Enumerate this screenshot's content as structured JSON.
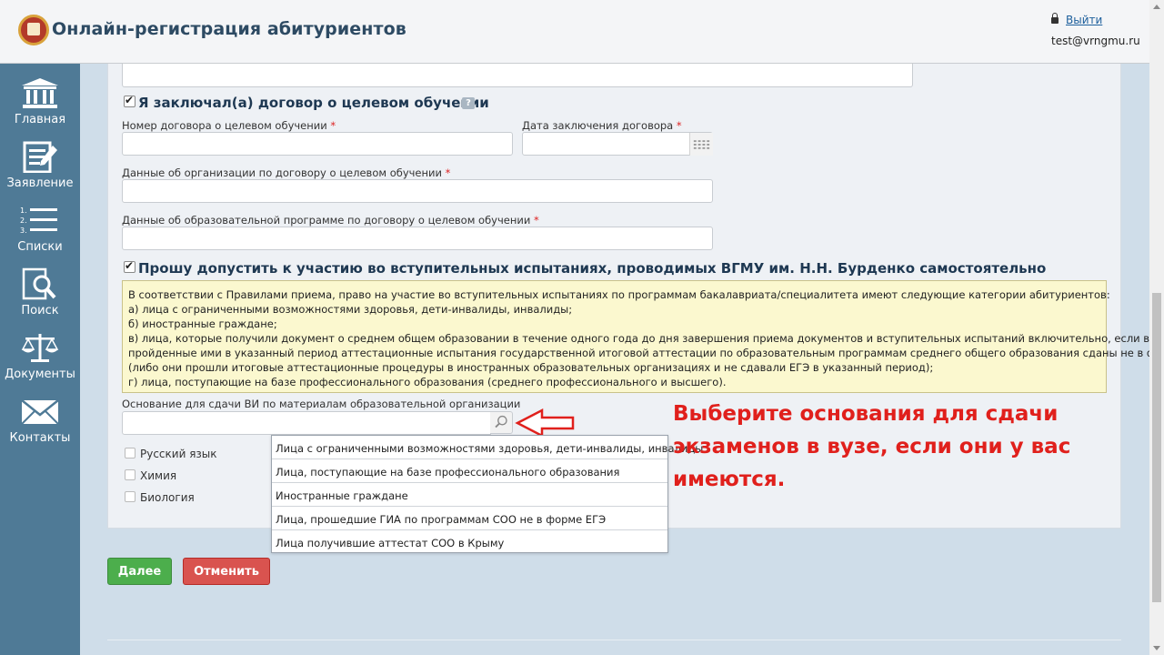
{
  "header": {
    "title": "Онлайн-регистрация абитуриентов",
    "logout_label": "Выйти",
    "user_email": "test@vrngmu.ru"
  },
  "sidebar": {
    "items": [
      {
        "label": "Главная",
        "icon": "building-icon"
      },
      {
        "label": "Заявление",
        "icon": "edit-form-icon"
      },
      {
        "label": "Списки",
        "icon": "numbered-list-icon"
      },
      {
        "label": "Поиск",
        "icon": "document-search-icon"
      },
      {
        "label": "Документы",
        "icon": "scales-icon"
      },
      {
        "label": "Контакты",
        "icon": "envelope-icon"
      }
    ]
  },
  "form": {
    "target_contract_checkbox": "Я заключал(а) договор о целевом обучении",
    "contract_number_label": "Номер договора о целевом обучении",
    "contract_date_label": "Дата заключения договора",
    "organization_label": "Данные об организации по договору о целевом обучении",
    "program_label": "Данные об образовательной программе по договору о целевом обучении",
    "required_mark": "*",
    "exam_checkbox": "Прошу допустить к участию во вступительных испытаниях, проводимых ВГМУ им. Н.Н. Бурденко самостоятельно",
    "notice_lines": [
      "В соответствии с Правилами приема, право на участие во вступительных испытаниях по программам бакалавриата/специалитета имеют следующие категории абитуриентов:",
      "а) лица с ограниченными возможностями здоровья, дети-инвалиды, инвалиды;",
      "б) иностранные граждане;",
      "в) лица, которые получили документ о среднем общем образовании в течение одного года до дня завершения приема документов и вступительных испытаний включительно, если все",
      "пройденные ими в указанный период аттестационные испытания государственной итоговой аттестации по образовательным программам среднего общего образования сданы не в форме ЕГЭ",
      "(либо они прошли итоговые аттестационные процедуры в иностранных образовательных организациях и не сдавали ЕГЭ в указанный период);",
      "г) лица, поступающие на базе профессионального образования (среднего профессионального и высшего)."
    ],
    "basis_label": "Основание для сдачи ВИ по материалам образовательной организации",
    "basis_value": "",
    "subjects": [
      "Русский язык",
      "Химия",
      "Биология"
    ],
    "basis_options": [
      "Лица с ограниченными возможностями здоровья, дети-инвалиды, инвалиды",
      "Лица, поступающие на базе профессионального образования",
      "Иностранные граждане",
      "Лица, прошедшие ГИА по программам СОО не в форме ЕГЭ",
      "Лица получившие аттестат СОО в Крыму"
    ]
  },
  "annotation": {
    "text": "Выберите основания для сдачи экзаменов в вузе, если они у вас имеются."
  },
  "actions": {
    "next_label": "Далее",
    "cancel_label": "Отменить"
  },
  "colors": {
    "sidebar": "#4f7a96",
    "next_button": "#4cae4c",
    "cancel_button": "#d9534f",
    "annotation": "#e0201c",
    "notice_bg": "#fbf8cf"
  }
}
